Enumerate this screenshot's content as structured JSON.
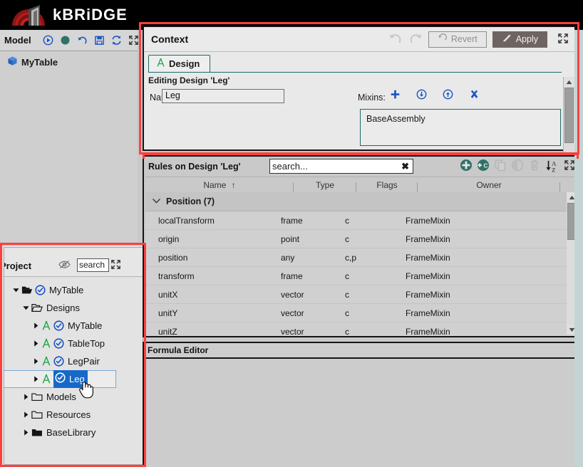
{
  "app": {
    "brand": "kBRiDGE"
  },
  "model_panel": {
    "title": "Model",
    "toolbar": [
      {
        "name": "run-icon",
        "label": "run"
      },
      {
        "name": "record-icon",
        "label": "record"
      },
      {
        "name": "undo-icon",
        "label": "undo"
      },
      {
        "name": "save-icon",
        "label": "save"
      },
      {
        "name": "refresh-icon",
        "label": "refresh"
      },
      {
        "name": "expand-icon",
        "label": "expand"
      }
    ],
    "tree_root": "MyTable"
  },
  "project_panel": {
    "title": "Project",
    "visibility_icon": "eye-slash-icon",
    "expand_icon": "expand-icon",
    "search_value": "search",
    "search_placeholder": "search",
    "tree": [
      {
        "label": "MyTable",
        "depth": 0,
        "twisty": "down",
        "icon": "folder-open-icon",
        "badge": "check-circle-icon",
        "selected": false
      },
      {
        "label": "Designs",
        "depth": 1,
        "twisty": "down",
        "icon": "folder-open-outline-icon",
        "badge": "",
        "selected": false
      },
      {
        "label": "MyTable",
        "depth": 2,
        "twisty": "right",
        "icon": "design-A-icon",
        "badge": "check-circle-icon",
        "selected": false
      },
      {
        "label": "TableTop",
        "depth": 2,
        "twisty": "right",
        "icon": "design-A-icon",
        "badge": "check-circle-icon",
        "selected": false
      },
      {
        "label": "LegPair",
        "depth": 2,
        "twisty": "right",
        "icon": "design-A-icon",
        "badge": "check-circle-icon",
        "selected": false
      },
      {
        "label": "Leg",
        "depth": 2,
        "twisty": "right",
        "icon": "design-A-icon",
        "badge": "check-circle-icon",
        "selected": true
      },
      {
        "label": "Models",
        "depth": 1,
        "twisty": "right",
        "icon": "folder-outline-icon",
        "badge": "",
        "selected": false
      },
      {
        "label": "Resources",
        "depth": 1,
        "twisty": "right",
        "icon": "folder-outline-icon",
        "badge": "",
        "selected": false
      },
      {
        "label": "BaseLibrary",
        "depth": 1,
        "twisty": "right",
        "icon": "folder-filled-icon",
        "badge": "",
        "selected": false
      }
    ]
  },
  "context_panel": {
    "title": "Context",
    "undo_icon": "undo-icon",
    "redo_icon": "redo-icon",
    "revert_label": "Revert",
    "apply_label": "Apply",
    "expand_icon": "expand-icon",
    "tab_label": "Design",
    "tab_icon": "design-A-icon",
    "editing_label": "Editing Design 'Leg'",
    "name_label": "Name:",
    "name_value": "Leg",
    "mixins_label": "Mixins:",
    "mixin_buttons": [
      {
        "name": "add-mixin-button",
        "glyph": "+"
      },
      {
        "name": "move-mixin-down-button",
        "glyph": "down"
      },
      {
        "name": "move-mixin-up-button",
        "glyph": "up"
      },
      {
        "name": "remove-mixin-button",
        "glyph": "x"
      }
    ],
    "mixins": [
      "BaseAssembly"
    ]
  },
  "rules_panel": {
    "title": "Rules on Design 'Leg'",
    "search_value": "search...",
    "search_placeholder": "search...",
    "clear_glyph": "✖",
    "toolbar": [
      {
        "name": "add-rule-button",
        "label": "add",
        "enabled": true
      },
      {
        "name": "add-child-rule-button",
        "label": "+C",
        "enabled": true
      },
      {
        "name": "copy-rule-button",
        "label": "copy",
        "enabled": false
      },
      {
        "name": "toggle-rule-button",
        "label": "toggle",
        "enabled": false
      },
      {
        "name": "delete-rule-button",
        "label": "delete",
        "enabled": false
      },
      {
        "name": "sort-az-button",
        "label": "A-Z",
        "enabled": true
      },
      {
        "name": "expand-button",
        "label": "expand",
        "enabled": true
      }
    ],
    "columns": [
      "Name",
      "Type",
      "Flags",
      "Owner"
    ],
    "sort_indicator": "↑",
    "groups": [
      {
        "label": "Position (7)",
        "expanded": true,
        "rows": [
          {
            "name": "localTransform",
            "type": "frame",
            "flags": "c",
            "owner": "FrameMixin"
          },
          {
            "name": "origin",
            "type": "point",
            "flags": "c",
            "owner": "FrameMixin"
          },
          {
            "name": "position",
            "type": "any",
            "flags": "c,p",
            "owner": "FrameMixin"
          },
          {
            "name": "transform",
            "type": "frame",
            "flags": "c",
            "owner": "FrameMixin"
          },
          {
            "name": "unitX",
            "type": "vector",
            "flags": "c",
            "owner": "FrameMixin"
          },
          {
            "name": "unitY",
            "type": "vector",
            "flags": "c",
            "owner": "FrameMixin"
          },
          {
            "name": "unitZ",
            "type": "vector",
            "flags": "c",
            "owner": "FrameMixin"
          }
        ]
      }
    ]
  },
  "formula_panel": {
    "title": "Formula Editor",
    "content": ""
  },
  "colors": {
    "highlight": "#fc4040",
    "accent_teal": "#1d6b63",
    "accent_blue": "#1a52c4",
    "selection_blue": "#1669c9",
    "apply_bg": "#6e6462",
    "logo_red": "#a81616"
  }
}
